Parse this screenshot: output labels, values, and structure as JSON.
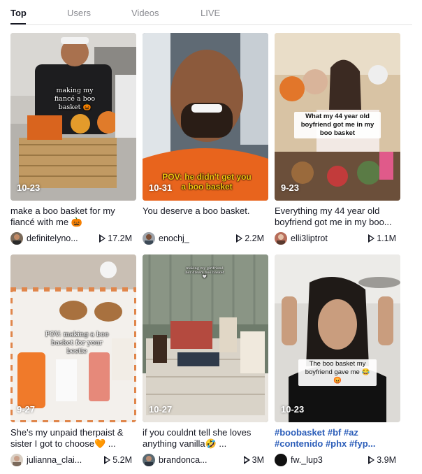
{
  "tabs": [
    {
      "label": "Top",
      "active": true
    },
    {
      "label": "Users",
      "active": false
    },
    {
      "label": "Videos",
      "active": false
    },
    {
      "label": "LIVE",
      "active": false
    }
  ],
  "videos": [
    {
      "date": "10-23",
      "overlay": "making my fiancé a boo basket 🎃",
      "caption": "make a boo basket for my fiancé with me 🎃",
      "author": "definitelyno...",
      "views": "17.2M"
    },
    {
      "date": "10-31",
      "overlay": "POV: he didn't get you a boo basket",
      "caption": "You deserve a boo basket.",
      "author": "enochj_",
      "views": "2.2M"
    },
    {
      "date": "9-23",
      "overlay": "What my 44 year old boyfriend got me in my boo basket",
      "caption": "Everything my 44 year old boyfriend got me in my boo...",
      "author": "elli3liptrot",
      "views": "1.1M"
    },
    {
      "date": "9-27",
      "overlay": "POV: making a boo basket for your bestie",
      "caption": "She's my unpaid therpaist & sister I got to choose🧡 ...",
      "author": "julianna_clai...",
      "views": "5.2M"
    },
    {
      "date": "10-27",
      "overlay": "making my girlfriend her dream boo basket🤍",
      "caption": "if you couldnt tell she loves anything vanilla🤣 ...",
      "author": "brandonca...",
      "views": "3M"
    },
    {
      "date": "10-23",
      "overlay": "The boo basket my boyfriend gave me 😂😡",
      "caption": "#boobasket #bf #az #contenido #phx #fyp...",
      "author": "fw._lup3",
      "views": "3.9M"
    }
  ]
}
